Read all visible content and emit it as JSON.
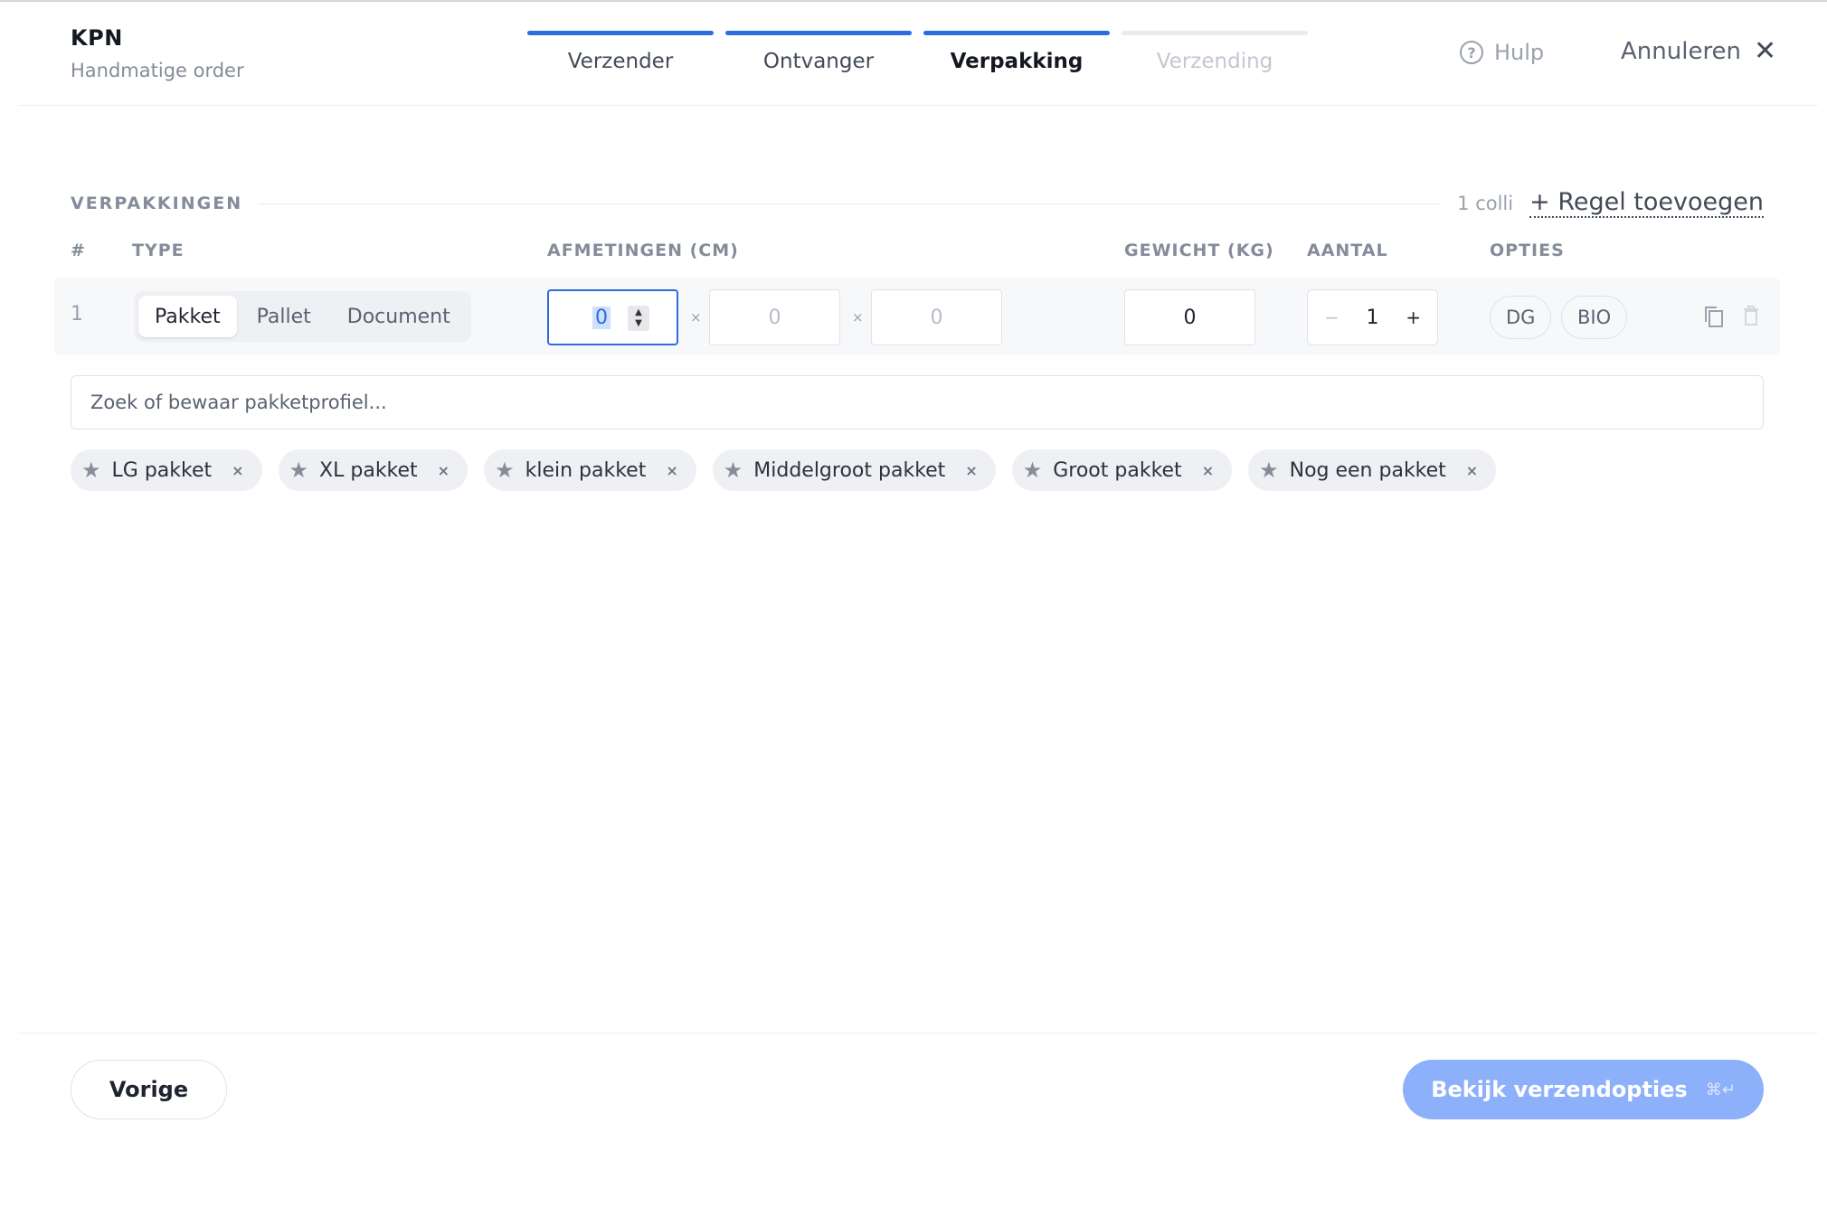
{
  "header": {
    "brand_name": "KPN",
    "brand_sub": "Handmatige order",
    "steps": [
      {
        "label": "Verzender",
        "state": "done"
      },
      {
        "label": "Ontvanger",
        "state": "done"
      },
      {
        "label": "Verpakking",
        "state": "active"
      },
      {
        "label": "Verzending",
        "state": "todo"
      }
    ],
    "help_label": "Hulp",
    "cancel_label": "Annuleren"
  },
  "section": {
    "title": "VERPAKKINGEN",
    "colli": "1 colli",
    "add_row_label": "+ Regel toevoegen"
  },
  "table": {
    "headers": {
      "num": "#",
      "type": "TYPE",
      "dimensions": "AFMETINGEN (CM)",
      "weight": "GEWICHT (KG)",
      "quantity": "AANTAL",
      "options": "OPTIES"
    },
    "row": {
      "num": "1",
      "types": [
        "Pakket",
        "Pallet",
        "Document"
      ],
      "selected_type": "Pakket",
      "length": "0",
      "width": "0",
      "height": "0",
      "times": "×",
      "weight": "0",
      "quantity": "1",
      "qty_minus": "−",
      "qty_plus": "+",
      "options": [
        "DG",
        "BIO"
      ]
    }
  },
  "search": {
    "placeholder": "Zoek of bewaar pakketprofiel..."
  },
  "profiles": [
    "LG pakket",
    "XL pakket",
    "klein pakket",
    "Middelgroot pakket",
    "Groot pakket",
    "Nog een pakket"
  ],
  "footer": {
    "prev_label": "Vorige",
    "next_label": "Bekijk verzendopties",
    "next_shortcut": "⌘↵"
  },
  "colors": {
    "accent": "#2d6ce0",
    "primary_button_disabled": "#8db0fa"
  }
}
